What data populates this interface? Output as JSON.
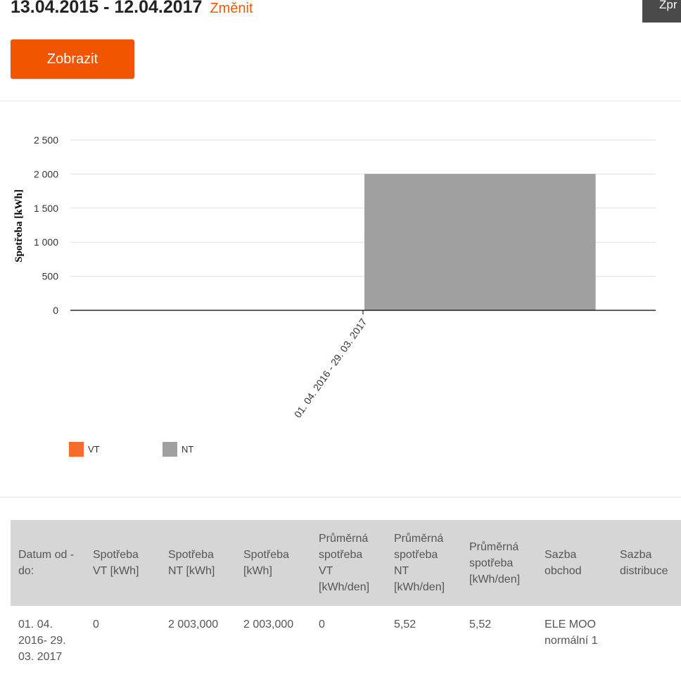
{
  "header": {
    "date_range": "13.04.2015 - 12.04.2017",
    "change_link": "Změnit",
    "top_right_button": "Zpr"
  },
  "actions": {
    "show_button": "Zobrazit"
  },
  "colors": {
    "accent": "#f25500",
    "vt": "#f46d2d",
    "nt": "#a0a0a0",
    "table_header_bg": "#d6d6d6"
  },
  "legend": [
    {
      "label": "VT",
      "color": "#f46d2d"
    },
    {
      "label": "NT",
      "color": "#a0a0a0"
    }
  ],
  "chart_data": {
    "type": "bar",
    "stacked": true,
    "categories": [
      "01. 04. 2016 - 29. 03. 2017"
    ],
    "series": [
      {
        "name": "VT",
        "values": [
          0
        ],
        "color": "#f46d2d"
      },
      {
        "name": "NT",
        "values": [
          2003
        ],
        "color": "#a0a0a0"
      }
    ],
    "ylabel": "Spotřeba [kWh]",
    "ylim": [
      0,
      2500
    ],
    "yticks": [
      0,
      500,
      1000,
      1500,
      2000,
      2500
    ],
    "ytick_labels": [
      "0",
      "500",
      "1 000",
      "1 500",
      "2 000",
      "2 500"
    ],
    "grid": true,
    "legend_position": "bottom-left"
  },
  "table": {
    "headers": [
      [
        "Datum od -",
        "do:"
      ],
      [
        "Spotřeba",
        "VT [kWh]"
      ],
      [
        "Spotřeba",
        "NT [kWh]"
      ],
      [
        "Spotřeba",
        "[kWh]"
      ],
      [
        "Průměrná",
        "spotřeba",
        "VT",
        "[kWh/den]"
      ],
      [
        "Průměrná",
        "spotřeba",
        "NT",
        "[kWh/den]"
      ],
      [
        "Průměrná",
        "spotřeba",
        "[kWh/den]"
      ],
      [
        "Sazba",
        "obchod"
      ],
      [
        "Sazba",
        "distribuce"
      ]
    ],
    "rows": [
      [
        [
          "01. 04.",
          "2016- 29.",
          "03. 2017"
        ],
        [
          "0"
        ],
        [
          "2 003,000"
        ],
        [
          "2 003,000"
        ],
        [
          "0"
        ],
        [
          "5,52"
        ],
        [
          "5,52"
        ],
        [
          "ELE MOO",
          "normální 1"
        ],
        [
          ""
        ]
      ]
    ]
  }
}
